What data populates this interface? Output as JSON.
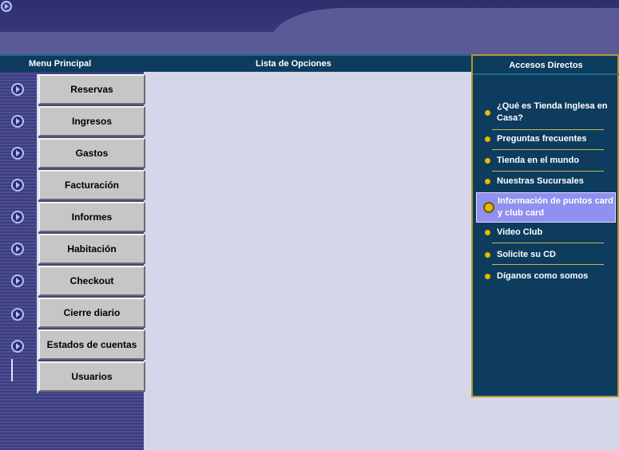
{
  "header": {
    "menu_title": "Menu Principal",
    "list_title": "Lista de Opciones",
    "shortcuts_title": "Accesos Directos"
  },
  "menu": {
    "items": [
      {
        "label": "Reservas"
      },
      {
        "label": "Ingresos"
      },
      {
        "label": "Gastos"
      },
      {
        "label": "Facturación"
      },
      {
        "label": "Informes"
      },
      {
        "label": "Habitación"
      },
      {
        "label": "Checkout"
      },
      {
        "label": "Cierre diario"
      },
      {
        "label": "Estados de cuentas"
      },
      {
        "label": "Usuarios"
      }
    ]
  },
  "shortcuts": {
    "items": [
      {
        "label": "¿Qué es Tienda Inglesa en Casa?"
      },
      {
        "label": "Preguntas frecuentes"
      },
      {
        "label": "Tienda en el mundo"
      },
      {
        "label": "Nuestras Sucursales"
      },
      {
        "label": "Información de puntos card y club card"
      },
      {
        "label": "Video Club"
      },
      {
        "label": "Solicite su CD"
      },
      {
        "label": "Díganos como somos"
      }
    ],
    "active_index": 4
  },
  "colors": {
    "banner": "#3c3d82",
    "header": "#0d3c5e",
    "accent_gold": "#e8b800",
    "active_highlight": "#9090f0",
    "content_bg": "#d6d6ea",
    "button_face": "#c6c6c6"
  },
  "icons": {
    "nav_icon": "circle-play-icon",
    "bullet": "bullet-dot-icon"
  }
}
